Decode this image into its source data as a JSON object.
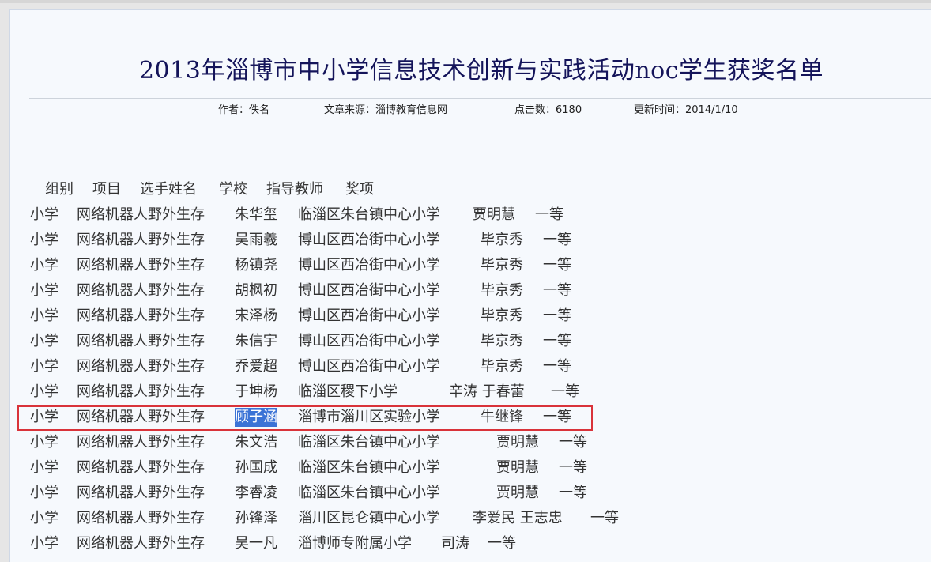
{
  "title": "2013年淄博市中小学信息技术创新与实践活动noc学生获奖名单",
  "meta": {
    "author_label": "作者：",
    "author": "佚名",
    "source_label": "文章来源：",
    "source": "淄博教育信息网",
    "hits_label": "点击数：",
    "hits": "6180",
    "updated_label": "更新时间：",
    "updated": "2014/1/10"
  },
  "columns": [
    "组别",
    "项目",
    "选手姓名",
    "学校",
    "指导教师",
    "奖项"
  ],
  "rows": [
    [
      "小学",
      "网络机器人野外生存",
      "朱华玺",
      "临淄区朱台镇中心小学",
      "贾明慧",
      "一等"
    ],
    [
      "小学",
      "网络机器人野外生存",
      "吴雨羲",
      "博山区西冶街中心小学",
      "毕京秀",
      "一等"
    ],
    [
      "小学",
      "网络机器人野外生存",
      "杨镇尧",
      "博山区西冶街中心小学",
      "毕京秀",
      "一等"
    ],
    [
      "小学",
      "网络机器人野外生存",
      "胡枫初",
      "博山区西冶街中心小学",
      "毕京秀",
      "一等"
    ],
    [
      "小学",
      "网络机器人野外生存",
      "宋泽杨",
      "博山区西冶街中心小学",
      "毕京秀",
      "一等"
    ],
    [
      "小学",
      "网络机器人野外生存",
      "朱信宇",
      "博山区西冶街中心小学",
      "毕京秀",
      "一等"
    ],
    [
      "小学",
      "网络机器人野外生存",
      "乔爱超",
      "博山区西冶街中心小学",
      "毕京秀",
      "一等"
    ],
    [
      "小学",
      "网络机器人野外生存",
      "于坤杨",
      "临淄区稷下小学",
      "辛涛 于春蕾",
      "一等"
    ],
    [
      "小学",
      "网络机器人野外生存",
      "顾子涵",
      "淄博市淄川区实验小学",
      "牛继锋",
      "一等"
    ],
    [
      "小学",
      "网络机器人野外生存",
      "朱文浩",
      "临淄区朱台镇中心小学",
      "贾明慧",
      "一等"
    ],
    [
      "小学",
      "网络机器人野外生存",
      "孙国成",
      "临淄区朱台镇中心小学",
      "贾明慧",
      "一等"
    ],
    [
      "小学",
      "网络机器人野外生存",
      "李睿凌",
      "临淄区朱台镇中心小学",
      "贾明慧",
      "一等"
    ],
    [
      "小学",
      "网络机器人野外生存",
      "孙锋泽",
      "淄川区昆仑镇中心小学",
      "李爱民 王志忠",
      "一等"
    ],
    [
      "小学",
      "网络机器人野外生存",
      "吴一凡",
      "淄博师专附属小学",
      "司涛",
      "一等"
    ]
  ],
  "selected_text": "顾子涵",
  "colors": {
    "title": "#14145a",
    "selection": "#3b73d6",
    "annotation_box": "#d9333a"
  }
}
